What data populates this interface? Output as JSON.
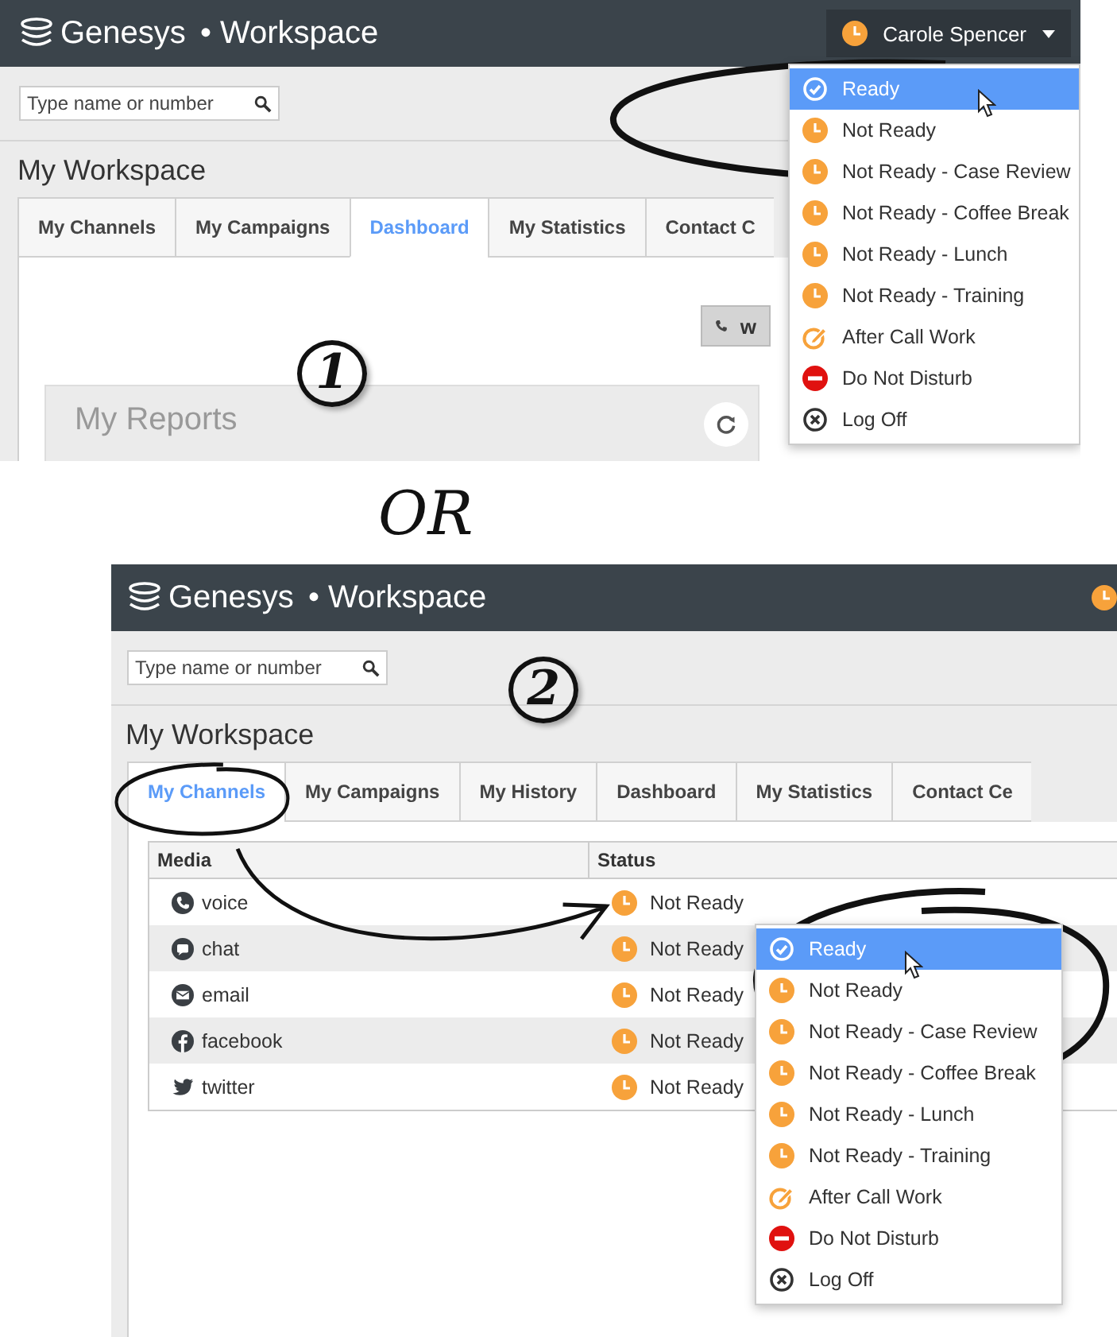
{
  "panel_1": {
    "brand": "Genesys",
    "app": "• Workspace",
    "user": {
      "name": "Carole Spencer"
    },
    "search": {
      "placeholder": "Type name or number"
    },
    "heading": "My Workspace",
    "tabs": [
      {
        "label": "My Channels",
        "selected": false
      },
      {
        "label": "My Campaigns",
        "selected": false
      },
      {
        "label": "Dashboard",
        "selected": true
      },
      {
        "label": "My Statistics",
        "selected": false
      },
      {
        "label": "Contact C",
        "selected": false
      }
    ],
    "voice_button": {
      "label": "w"
    },
    "reports_card": {
      "title": "My Reports"
    },
    "step": "1",
    "status_menu": [
      {
        "label": "Ready",
        "kind": "ready",
        "selected": true
      },
      {
        "label": "Not Ready",
        "kind": "not_ready",
        "selected": false
      },
      {
        "label": "Not Ready - Case Review",
        "kind": "not_ready",
        "selected": false
      },
      {
        "label": "Not Ready - Coffee Break",
        "kind": "not_ready",
        "selected": false
      },
      {
        "label": "Not Ready - Lunch",
        "kind": "not_ready",
        "selected": false
      },
      {
        "label": "Not Ready - Training",
        "kind": "not_ready",
        "selected": false
      },
      {
        "label": "After Call Work",
        "kind": "acw",
        "selected": false
      },
      {
        "label": "Do Not Disturb",
        "kind": "dnd",
        "selected": false
      },
      {
        "label": "Log Off",
        "kind": "logoff",
        "selected": false
      }
    ]
  },
  "separator": "OR",
  "panel_2": {
    "brand": "Genesys",
    "app": "• Workspace",
    "search": {
      "placeholder": "Type name or number"
    },
    "heading": "My Workspace",
    "step": "2",
    "tabs": [
      {
        "label": "My Channels",
        "selected": true
      },
      {
        "label": "My Campaigns",
        "selected": false
      },
      {
        "label": "My History",
        "selected": false
      },
      {
        "label": "Dashboard",
        "selected": false
      },
      {
        "label": "My Statistics",
        "selected": false
      },
      {
        "label": "Contact Ce",
        "selected": false
      }
    ],
    "table": {
      "columns": [
        "Media",
        "Status"
      ],
      "rows": [
        {
          "media": "voice",
          "kind": "voice",
          "status": "Not Ready"
        },
        {
          "media": "chat",
          "kind": "chat",
          "status": "Not Ready"
        },
        {
          "media": "email",
          "kind": "email",
          "status": "Not Ready"
        },
        {
          "media": "facebook",
          "kind": "facebook",
          "status": "Not Ready"
        },
        {
          "media": "twitter",
          "kind": "twitter",
          "status": "Not Ready"
        }
      ]
    },
    "status_menu": [
      {
        "label": "Ready",
        "kind": "ready",
        "selected": true
      },
      {
        "label": "Not Ready",
        "kind": "not_ready",
        "selected": false
      },
      {
        "label": "Not Ready - Case Review",
        "kind": "not_ready",
        "selected": false
      },
      {
        "label": "Not Ready - Coffee Break",
        "kind": "not_ready",
        "selected": false
      },
      {
        "label": "Not Ready - Lunch",
        "kind": "not_ready",
        "selected": false
      },
      {
        "label": "Not Ready - Training",
        "kind": "not_ready",
        "selected": false
      },
      {
        "label": "After Call Work",
        "kind": "acw",
        "selected": false
      },
      {
        "label": "Do Not Disturb",
        "kind": "dnd",
        "selected": false
      },
      {
        "label": "Log Off",
        "kind": "logoff",
        "selected": false
      }
    ]
  }
}
